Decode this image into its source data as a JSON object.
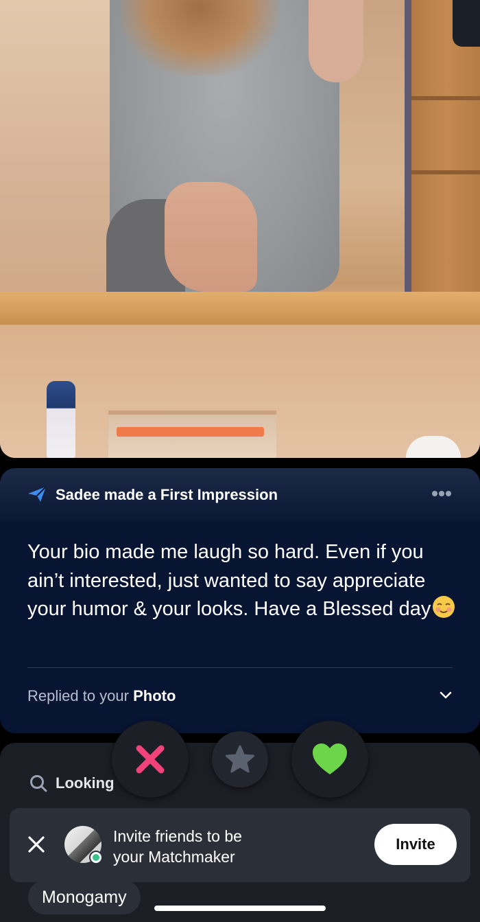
{
  "impression": {
    "header_title": "Sadee made a First Impression",
    "message": "Your bio made me laugh so hard. Even if you ain’t interested, just wanted to say appreciate your humor & your looks. Have a Blessed day",
    "reply_prefix": "Replied to your ",
    "reply_target": "Photo"
  },
  "lower": {
    "section_label": "Looking",
    "chip": "Monogamy"
  },
  "banner": {
    "text_line1": "Invite friends to be",
    "text_line2": "your Matchmaker",
    "invite_label": "Invite"
  },
  "colors": {
    "card_bg": "#071533",
    "accent_blue": "#3c8cf0",
    "pass_pink": "#f0437a",
    "like_green": "#6cd54a",
    "star_gray": "#5a6270"
  },
  "icons": {
    "header": "paper-plane-icon",
    "more": "more-dots-icon",
    "expand": "chevron-down-icon",
    "search": "search-icon",
    "pass": "close-x-icon",
    "superlike": "star-icon",
    "like": "heart-icon",
    "banner_close": "close-icon"
  }
}
